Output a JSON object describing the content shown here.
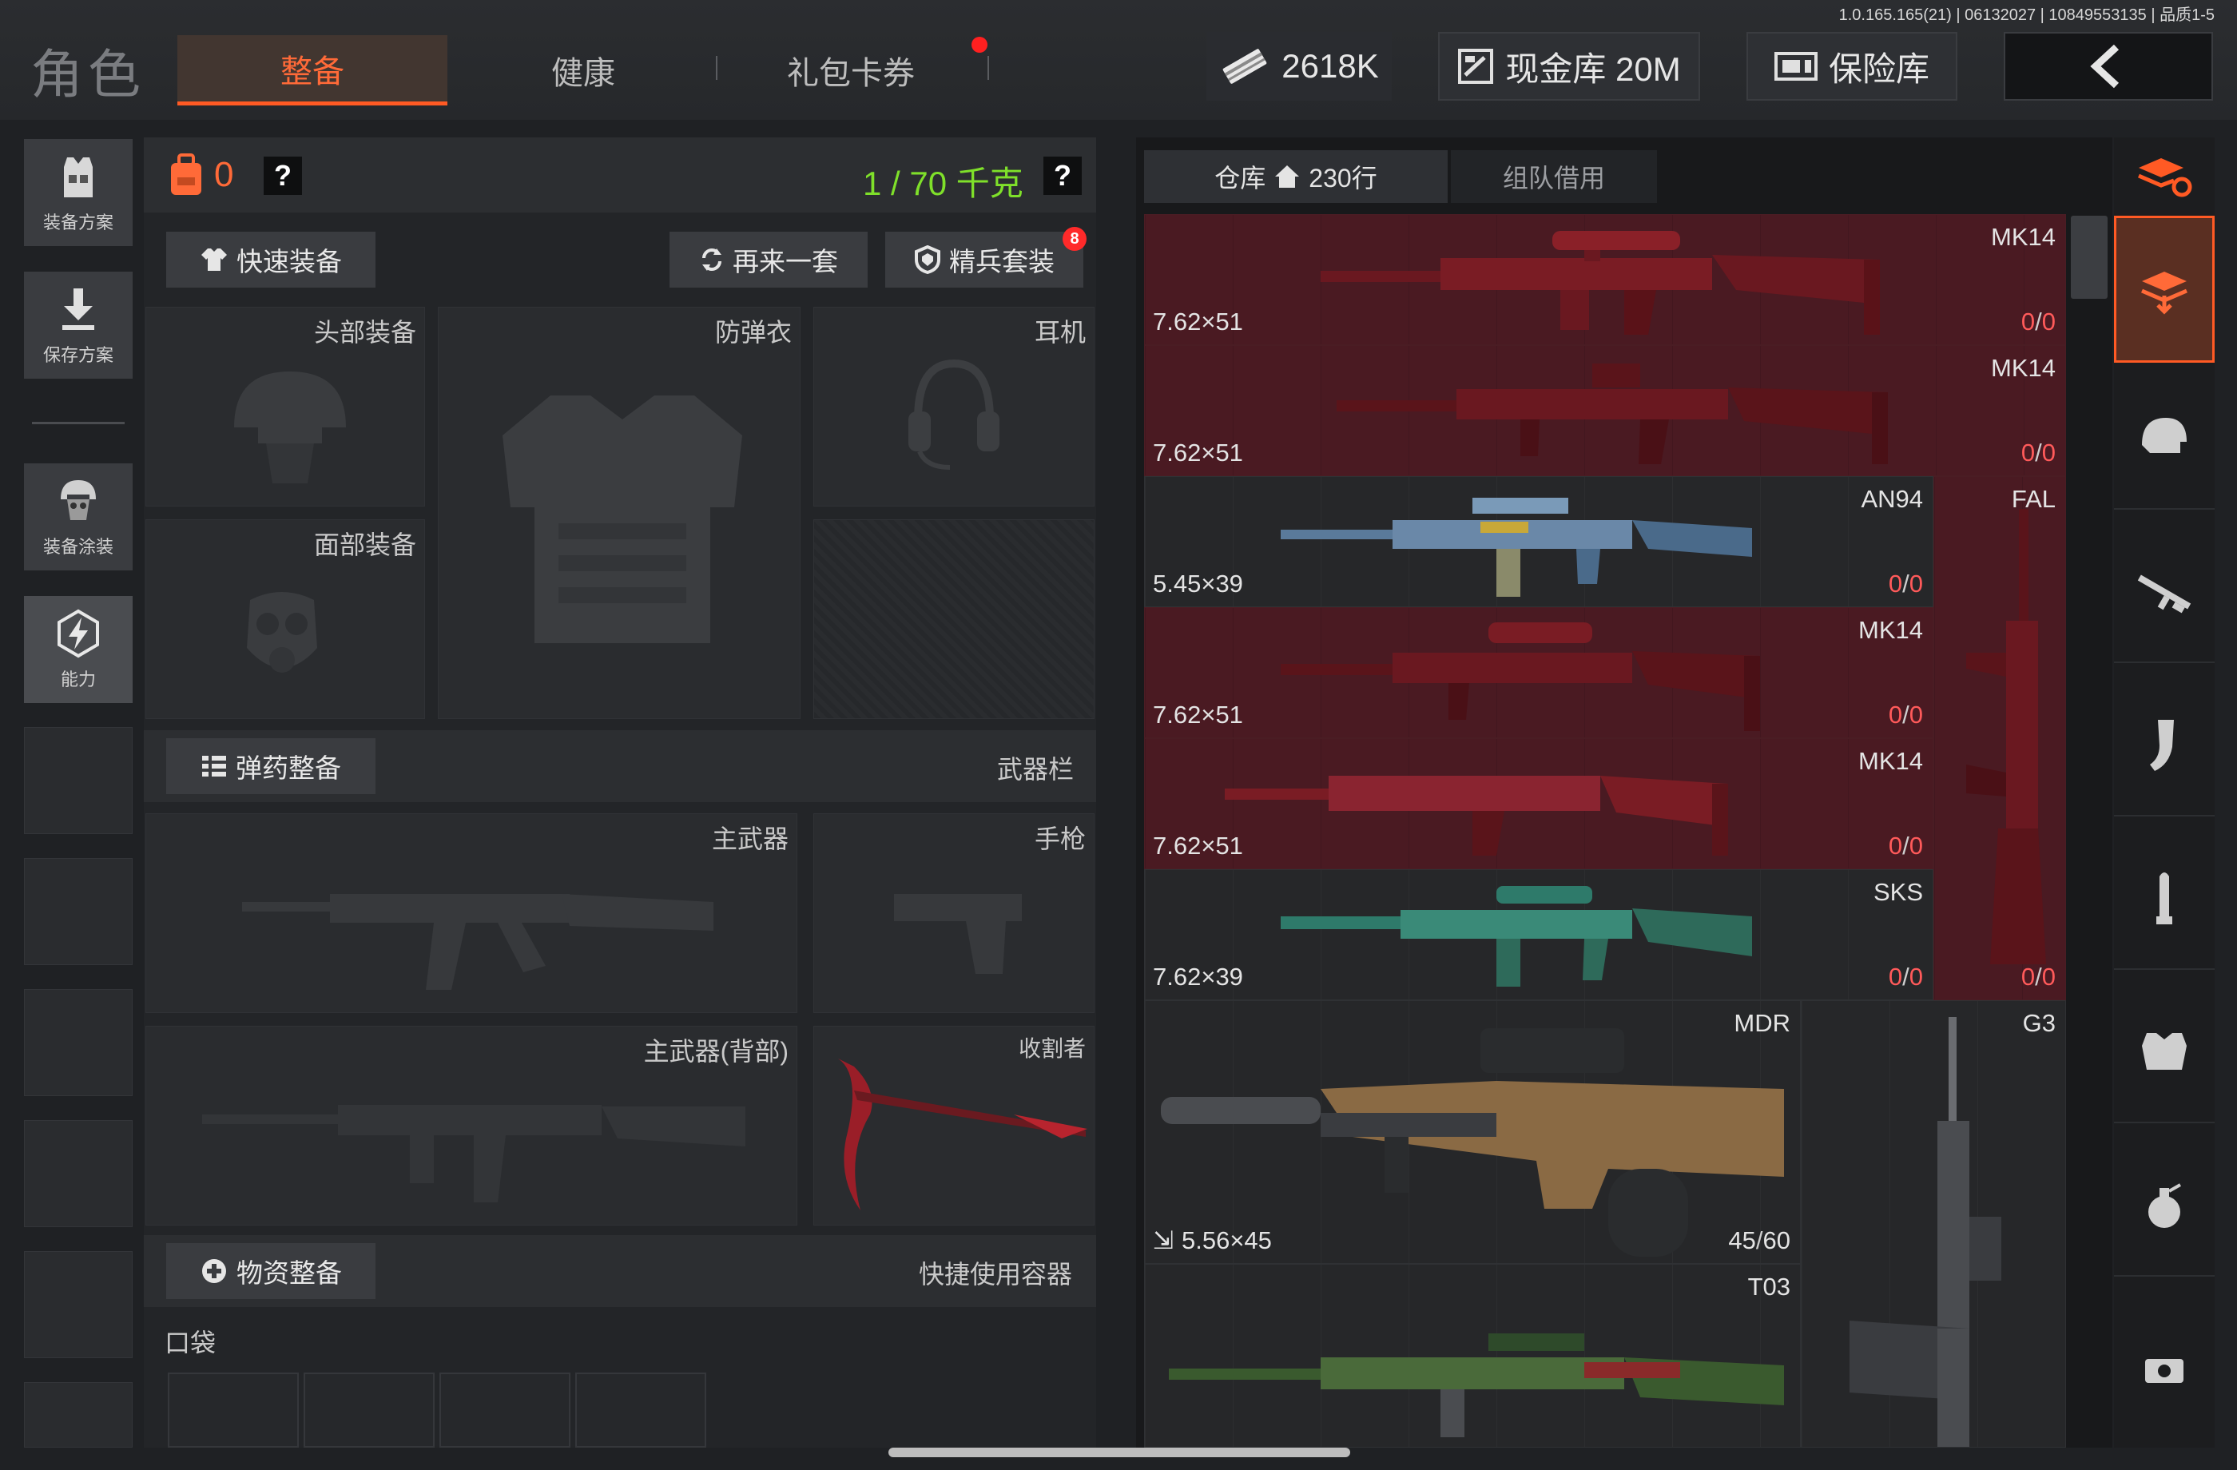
{
  "version": "1.0.165.165(21) | 06132027 | 10849553135 | 品质1-5",
  "header": {
    "title": "角色",
    "tabs": [
      {
        "label": "整备",
        "active": true
      },
      {
        "label": "健康",
        "active": false
      },
      {
        "label": "礼包卡券",
        "active": false,
        "notify": true
      }
    ],
    "money": "2618K",
    "cash_vault": "现金库 20M",
    "safe": "保险库"
  },
  "left_rail": {
    "plan": "装备方案",
    "save": "保存方案",
    "skin": "装备涂装",
    "ability": "能力"
  },
  "equip": {
    "bag_count": "0",
    "weight": "1 / 70 千克",
    "quick_equip": "快速装备",
    "again": "再来一套",
    "elite": "精兵套装",
    "elite_badge": "8",
    "slots": {
      "head": "头部装备",
      "vest": "防弹衣",
      "ear": "耳机",
      "face": "面部装备",
      "primary": "主武器",
      "pistol": "手枪",
      "primary_back": "主武器(背部)",
      "melee": "收割者"
    },
    "ammo_btn": "弹药整备",
    "weapon_bar": "武器栏",
    "supply_btn": "物资整备",
    "quick_container": "快捷使用容器",
    "pocket": "口袋"
  },
  "warehouse": {
    "tab_main": "仓库",
    "rows": "230行",
    "tab_team": "组队借用",
    "items": [
      {
        "name": "MK14",
        "caliber": "7.62×51",
        "dur_a": "0",
        "dur_b": "0"
      },
      {
        "name": "MK14",
        "caliber": "7.62×51",
        "dur_a": "0",
        "dur_b": "0"
      },
      {
        "name": "AN94",
        "caliber": "5.45×39",
        "dur_a": "0",
        "dur_b": "0"
      },
      {
        "name": "FAL",
        "caliber": "",
        "dur_a": "0",
        "dur_b": "0"
      },
      {
        "name": "MK14",
        "caliber": "7.62×51",
        "dur_a": "0",
        "dur_b": "0"
      },
      {
        "name": "MK14",
        "caliber": "7.62×51",
        "dur_a": "0",
        "dur_b": "0"
      },
      {
        "name": "SKS",
        "caliber": "7.62×39",
        "dur_a": "0",
        "dur_b": "0"
      },
      {
        "name": "MDR",
        "caliber": "5.56×45",
        "dur_a": "45",
        "dur_b": "60"
      },
      {
        "name": "G3",
        "caliber": "",
        "dur_a": "",
        "dur_b": ""
      },
      {
        "name": "T03",
        "caliber": "",
        "dur_a": "",
        "dur_b": ""
      }
    ]
  },
  "categories": [
    "refresh-icon",
    "all-items-icon",
    "helmet-icon",
    "rifle-icon",
    "magazine-icon",
    "ammo-icon",
    "armor-icon",
    "grenade-icon",
    "misc-icon"
  ],
  "colors": {
    "accent": "#ff5a24",
    "weight_ok": "#7fe02a",
    "durability_zero": "#ff5a5a",
    "item_bg_red": "#4a1a22"
  }
}
